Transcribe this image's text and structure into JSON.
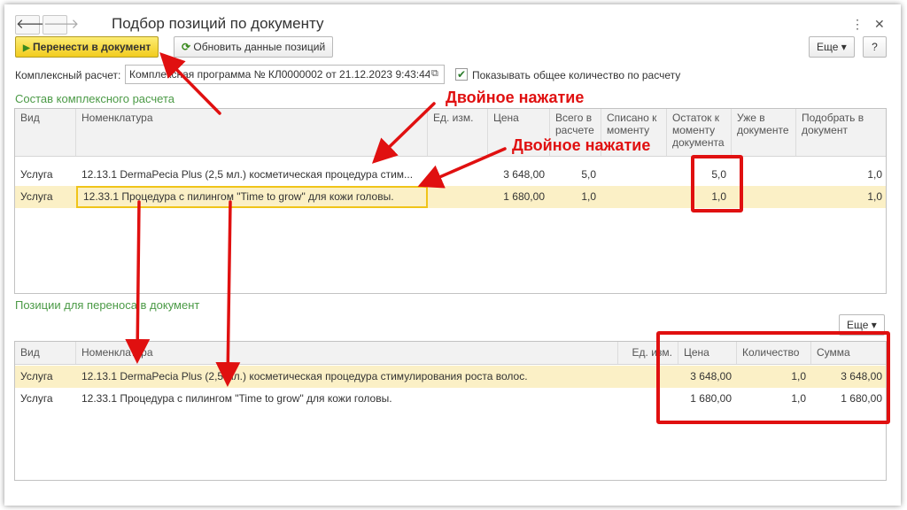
{
  "window": {
    "title": "Подбор позиций по документу",
    "back_icon": "arrow-left-icon",
    "forward_icon": "arrow-right-icon",
    "more_icon": "vertical-dots-icon",
    "close_icon": "close-icon"
  },
  "toolbar": {
    "transfer_label": "Перенести в документ",
    "refresh_label": "Обновить данные позиций",
    "more_label": "Еще ▾",
    "help_label": "?"
  },
  "complex": {
    "label": "Комплексный расчет:",
    "value": "Комплексная программа № КЛ0000002 от 21.12.2023 9:43:44",
    "show_total_label": "Показывать общее количество по расчету",
    "show_total_checked": true
  },
  "section1": {
    "title": "Состав комплексного расчета",
    "columns": [
      "Вид",
      "Номенклатура",
      "Ед. изм.",
      "Цена",
      "Всего в расчете",
      "Списано к моменту",
      "Остаток к моменту документа",
      "Уже в документе",
      "Подобрать в документ"
    ],
    "rows": [
      {
        "vid": "Услуга",
        "nom": "12.13.1 DermaPecia Plus (2,5 мл.) косметическая процедура стим...",
        "unit": "",
        "price": "3 648,00",
        "total": "5,0",
        "written": "",
        "rest": "5,0",
        "already": "",
        "pick": "1,0"
      },
      {
        "vid": "Услуга",
        "nom": "12.33.1 Процедура с пилингом \"Time to grow\" для кожи головы.",
        "unit": "",
        "price": "1 680,00",
        "total": "1,0",
        "written": "",
        "rest": "1,0",
        "already": "",
        "pick": "1,0"
      }
    ]
  },
  "section2": {
    "title": "Позиции для переноса в документ",
    "more_label": "Еще ▾",
    "columns": [
      "Вид",
      "Номенклатура",
      "Ед. изм.",
      "Цена",
      "Количество",
      "Сумма"
    ],
    "rows": [
      {
        "vid": "Услуга",
        "nom": "12.13.1 DermaPecia Plus (2,5 мл.) косметическая процедура стимулирования роста волос.",
        "unit": "",
        "price": "3 648,00",
        "qty": "1,0",
        "sum": "3 648,00"
      },
      {
        "vid": "Услуга",
        "nom": "12.33.1 Процедура с пилингом \"Time to grow\" для кожи головы.",
        "unit": "",
        "price": "1 680,00",
        "qty": "1,0",
        "sum": "1 680,00"
      }
    ]
  },
  "annotations": {
    "double_click_1": "Двойное нажатие",
    "double_click_2": "Двойное нажатие",
    "color": "#e01010"
  },
  "colors": {
    "section_title": "#4b9a46",
    "selected_row": "#fbf0c6",
    "primary_button": "#f2cc1e"
  }
}
